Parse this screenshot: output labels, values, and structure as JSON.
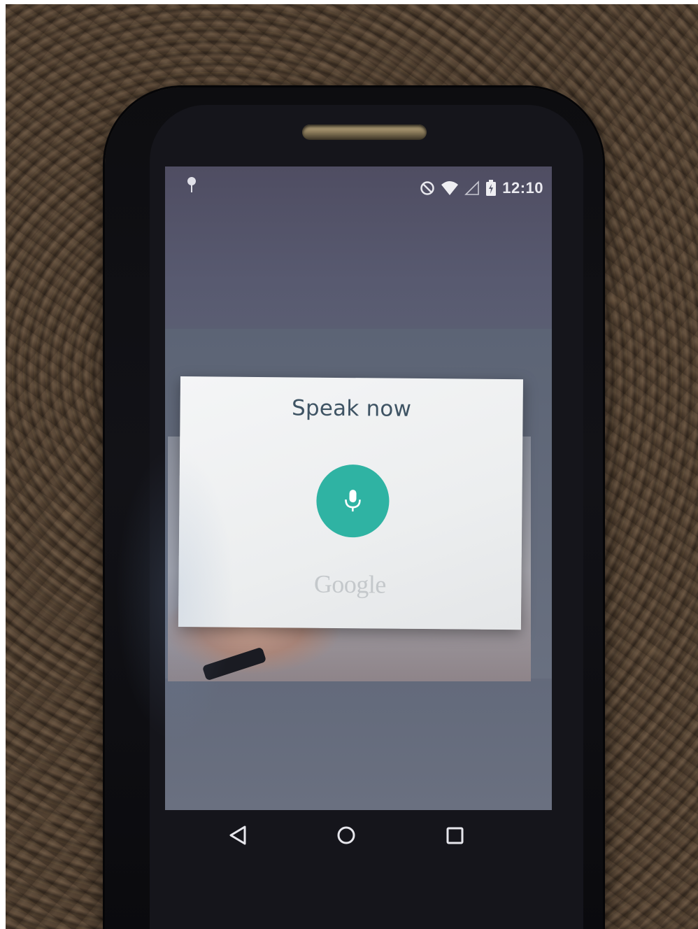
{
  "statusbar": {
    "time": "12:10",
    "icons": [
      "debug-bug-icon",
      "do-not-disturb-icon",
      "wifi-icon",
      "cell-signal-icon",
      "battery-charging-icon"
    ]
  },
  "voice_dialog": {
    "title": "Speak now",
    "mic_icon": "microphone-icon",
    "brand": "Google",
    "accent_color": "#2fb3a3"
  },
  "navbar": {
    "icons": [
      "back-icon",
      "home-icon",
      "recents-icon"
    ]
  }
}
